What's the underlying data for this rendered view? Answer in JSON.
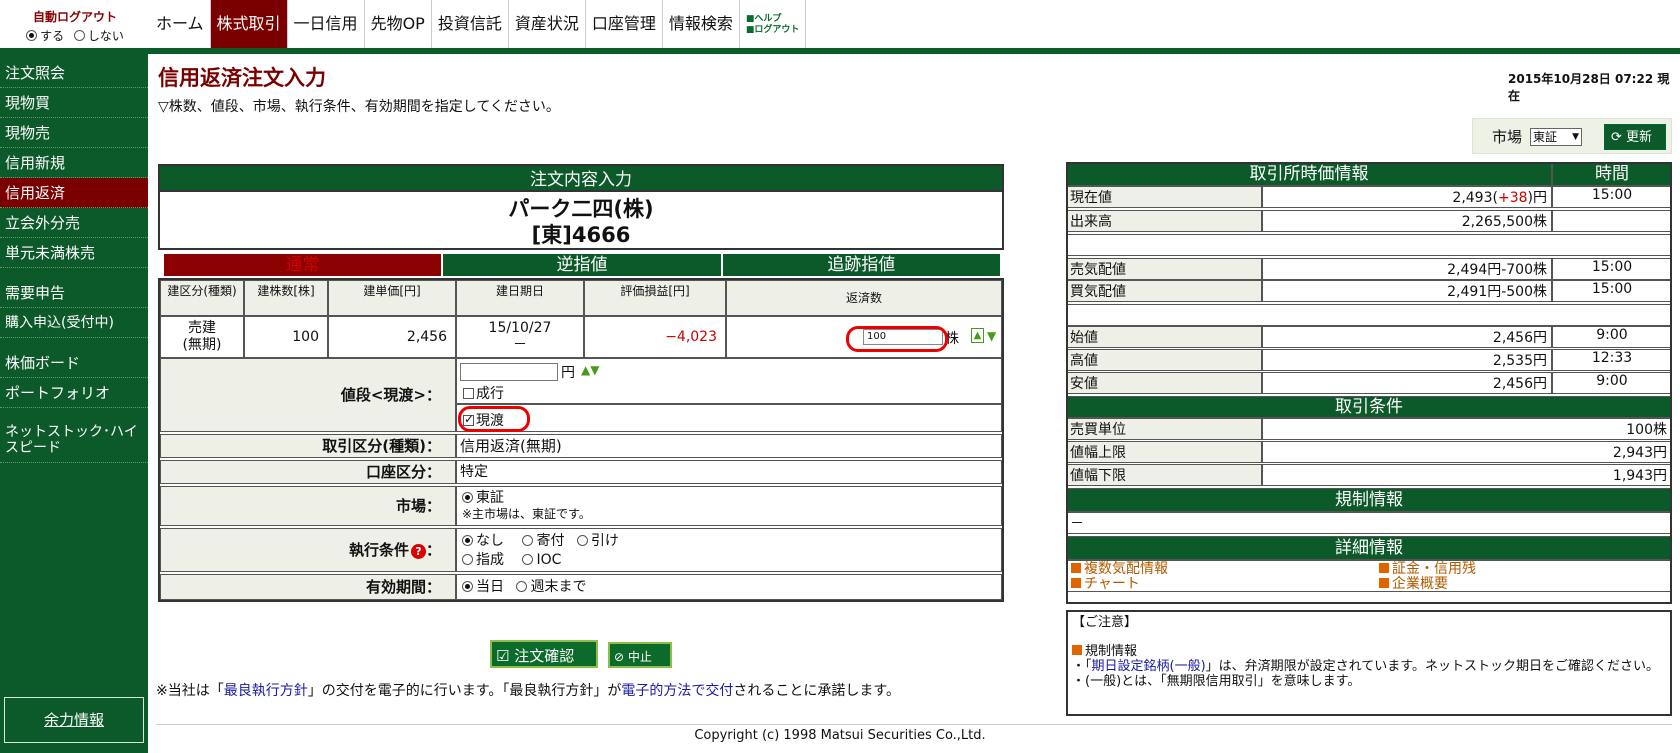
{
  "logout": {
    "title": "自動ログアウト",
    "on": "する",
    "off": "しない"
  },
  "topnav": [
    "ホーム",
    "株式取引",
    "一日信用",
    "先物OP",
    "投資信託",
    "資産状況",
    "口座管理",
    "情報検索"
  ],
  "help": {
    "l1": "■ヘルプ",
    "l2": "■ログアウト"
  },
  "sidebar": [
    {
      "label": "注文照会"
    },
    {
      "label": "現物買"
    },
    {
      "label": "現物売"
    },
    {
      "label": "信用新規"
    },
    {
      "label": "信用返済"
    },
    {
      "label": "立会外分売"
    },
    {
      "label": "単元未満株売"
    },
    {
      "label": "需要申告"
    },
    {
      "label": "購入申込(受付中)"
    },
    {
      "label": "株価ボード"
    },
    {
      "label": "ポートフォリオ"
    },
    {
      "label": "ネットストック･ハイスピード"
    }
  ],
  "yoryoku": "余力情報",
  "page": {
    "title": "信用返済注文入力",
    "desc": "▽株数、値段、市場、執行条件、有効期間を指定してください。",
    "date": "2015年10月28日 07:22 現在"
  },
  "market_sel": {
    "label": "市場",
    "value": "東証",
    "refresh": "更新"
  },
  "order": {
    "head": "注文内容入力",
    "stock_name": "パーク二四(株)",
    "stock_code": "[東]4666",
    "tabs": [
      "通常",
      "逆指値",
      "追跡指値"
    ],
    "cols": [
      "建区分(種類)",
      "建株数[株]",
      "建単価[円]",
      "建日期日",
      "評価損益[円]",
      "返済数"
    ],
    "row": {
      "type1": "売建",
      "type2": "(無期)",
      "qty": "100",
      "price": "2,456",
      "date1": "15/10/27",
      "date2": "－",
      "pl": "−4,023",
      "repay": "100",
      "unit": "株"
    },
    "price_label": "値段<現渡>：",
    "yen": "円",
    "nari": "成行",
    "genwatashi": "現渡",
    "kind_label": "取引区分(種類)：",
    "kind": "信用返済(無期)",
    "acct_label": "口座区分：",
    "acct": "特定",
    "mkt_label": "市場：",
    "mkt": "東証",
    "mkt_note": "※主市場は、東証です。",
    "cond_label": "執行条件",
    "cond": [
      "なし",
      "寄付",
      "引け",
      "指成",
      "IOC"
    ],
    "period_label": "有効期間：",
    "period": [
      "当日",
      "週末まで"
    ]
  },
  "buttons": {
    "confirm": "注文確認",
    "cancel": "中止"
  },
  "disclaimer": {
    "a": "※当社は「",
    "b": "最良執行方針",
    "c": "」の交付を電子的に行います。「最良執行方針」が",
    "d": "電子的方法で交付",
    "e": "されることに承諾します。"
  },
  "quote": {
    "head": "取引所時価情報",
    "time_head": "時間",
    "rows": [
      {
        "label": "現在値",
        "value": "2,493",
        "chg": "+38",
        "unit": "円",
        "time": "15:00"
      },
      {
        "label": "出来高",
        "value": "2,265,500株",
        "time": ""
      },
      {
        "label": "売気配値",
        "value": "2,494円-700株",
        "time": "15:00"
      },
      {
        "label": "買気配値",
        "value": "2,491円-500株",
        "time": "15:00"
      },
      {
        "label": "始値",
        "value": "2,456円",
        "time": "9:00"
      },
      {
        "label": "高値",
        "value": "2,535円",
        "time": "12:33"
      },
      {
        "label": "安値",
        "value": "2,456円",
        "time": "9:00"
      }
    ]
  },
  "conditions": {
    "head": "取引条件",
    "rows": [
      {
        "label": "売買単位",
        "value": "100株"
      },
      {
        "label": "値幅上限",
        "value": "2,943円"
      },
      {
        "label": "値幅下限",
        "value": "1,943円"
      }
    ]
  },
  "regulation": {
    "head": "規制情報",
    "value": "－"
  },
  "detail": {
    "head": "詳細情報",
    "links": [
      "複数気配情報",
      "証金・信用残",
      "チャート",
      "企業概要"
    ]
  },
  "notice": {
    "title": "【ご注意】",
    "sub": "規制情報",
    "l1a": "・「",
    "l1b": "期日設定銘柄(一般)",
    "l1c": "」は、弁済期限が設定されています。ネットストック期日をご確認ください。",
    "l2": "・(一般)とは、「無期限信用取引」を意味します。"
  },
  "copyright": "Copyright (c) 1998 Matsui Securities Co.,Ltd.",
  "colors": {
    "green": "#0c5a2a",
    "maroon": "#7a0000"
  }
}
